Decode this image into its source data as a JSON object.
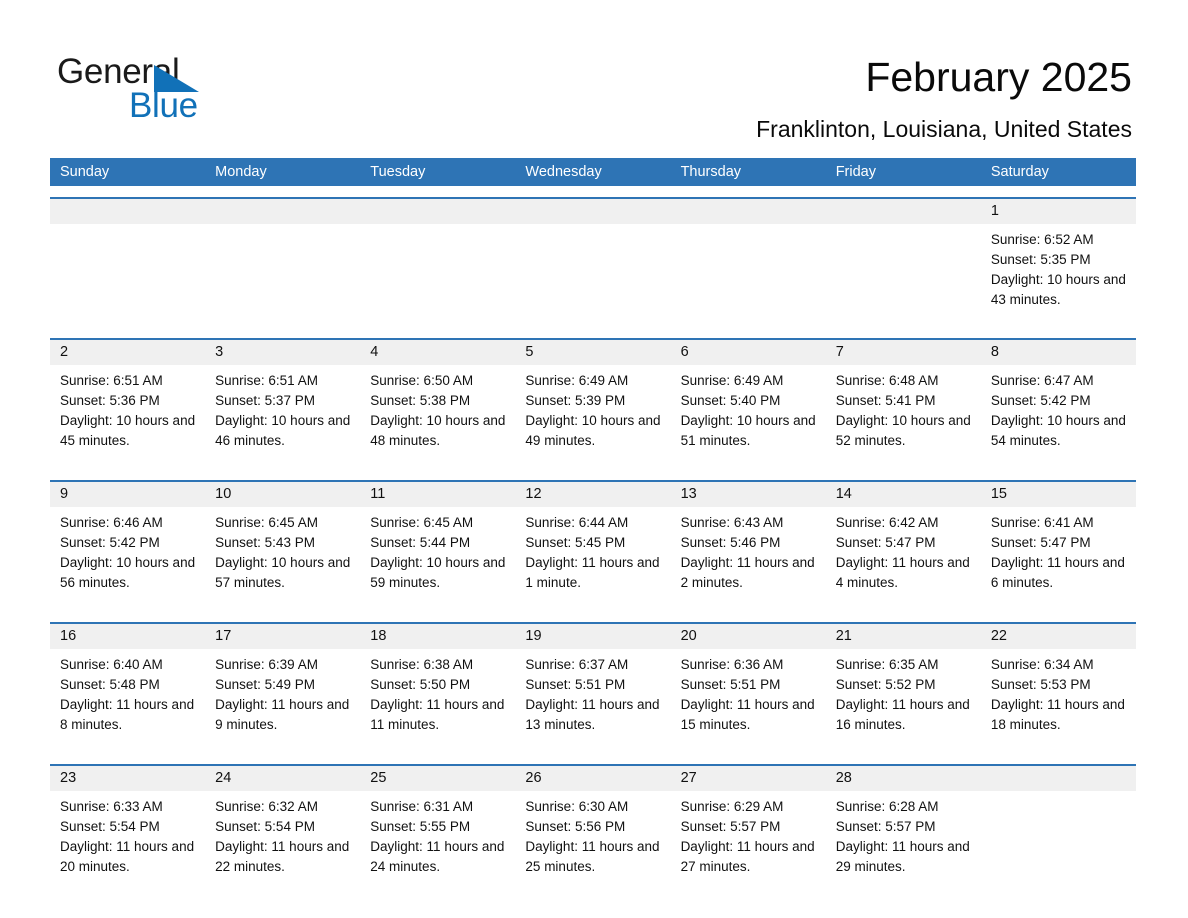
{
  "brand": {
    "name_part1": "General",
    "name_part2": "Blue",
    "triangle_color": "#1171b8"
  },
  "header": {
    "title": "February 2025",
    "subtitle": "Franklinton, Louisiana, United States",
    "header_bg_color": "#2e74b5",
    "row_divider_color": "#2e74b5",
    "daynum_band_color": "#f0f0f0"
  },
  "weekdays": [
    "Sunday",
    "Monday",
    "Tuesday",
    "Wednesday",
    "Thursday",
    "Friday",
    "Saturday"
  ],
  "weeks": [
    {
      "days": [
        {
          "num": "",
          "sunrise": "",
          "sunset": "",
          "daylight": ""
        },
        {
          "num": "",
          "sunrise": "",
          "sunset": "",
          "daylight": ""
        },
        {
          "num": "",
          "sunrise": "",
          "sunset": "",
          "daylight": ""
        },
        {
          "num": "",
          "sunrise": "",
          "sunset": "",
          "daylight": ""
        },
        {
          "num": "",
          "sunrise": "",
          "sunset": "",
          "daylight": ""
        },
        {
          "num": "",
          "sunrise": "",
          "sunset": "",
          "daylight": ""
        },
        {
          "num": "1",
          "sunrise": "Sunrise: 6:52 AM",
          "sunset": "Sunset: 5:35 PM",
          "daylight": "Daylight: 10 hours and 43 minutes."
        }
      ]
    },
    {
      "days": [
        {
          "num": "2",
          "sunrise": "Sunrise: 6:51 AM",
          "sunset": "Sunset: 5:36 PM",
          "daylight": "Daylight: 10 hours and 45 minutes."
        },
        {
          "num": "3",
          "sunrise": "Sunrise: 6:51 AM",
          "sunset": "Sunset: 5:37 PM",
          "daylight": "Daylight: 10 hours and 46 minutes."
        },
        {
          "num": "4",
          "sunrise": "Sunrise: 6:50 AM",
          "sunset": "Sunset: 5:38 PM",
          "daylight": "Daylight: 10 hours and 48 minutes."
        },
        {
          "num": "5",
          "sunrise": "Sunrise: 6:49 AM",
          "sunset": "Sunset: 5:39 PM",
          "daylight": "Daylight: 10 hours and 49 minutes."
        },
        {
          "num": "6",
          "sunrise": "Sunrise: 6:49 AM",
          "sunset": "Sunset: 5:40 PM",
          "daylight": "Daylight: 10 hours and 51 minutes."
        },
        {
          "num": "7",
          "sunrise": "Sunrise: 6:48 AM",
          "sunset": "Sunset: 5:41 PM",
          "daylight": "Daylight: 10 hours and 52 minutes."
        },
        {
          "num": "8",
          "sunrise": "Sunrise: 6:47 AM",
          "sunset": "Sunset: 5:42 PM",
          "daylight": "Daylight: 10 hours and 54 minutes."
        }
      ]
    },
    {
      "days": [
        {
          "num": "9",
          "sunrise": "Sunrise: 6:46 AM",
          "sunset": "Sunset: 5:42 PM",
          "daylight": "Daylight: 10 hours and 56 minutes."
        },
        {
          "num": "10",
          "sunrise": "Sunrise: 6:45 AM",
          "sunset": "Sunset: 5:43 PM",
          "daylight": "Daylight: 10 hours and 57 minutes."
        },
        {
          "num": "11",
          "sunrise": "Sunrise: 6:45 AM",
          "sunset": "Sunset: 5:44 PM",
          "daylight": "Daylight: 10 hours and 59 minutes."
        },
        {
          "num": "12",
          "sunrise": "Sunrise: 6:44 AM",
          "sunset": "Sunset: 5:45 PM",
          "daylight": "Daylight: 11 hours and 1 minute."
        },
        {
          "num": "13",
          "sunrise": "Sunrise: 6:43 AM",
          "sunset": "Sunset: 5:46 PM",
          "daylight": "Daylight: 11 hours and 2 minutes."
        },
        {
          "num": "14",
          "sunrise": "Sunrise: 6:42 AM",
          "sunset": "Sunset: 5:47 PM",
          "daylight": "Daylight: 11 hours and 4 minutes."
        },
        {
          "num": "15",
          "sunrise": "Sunrise: 6:41 AM",
          "sunset": "Sunset: 5:47 PM",
          "daylight": "Daylight: 11 hours and 6 minutes."
        }
      ]
    },
    {
      "days": [
        {
          "num": "16",
          "sunrise": "Sunrise: 6:40 AM",
          "sunset": "Sunset: 5:48 PM",
          "daylight": "Daylight: 11 hours and 8 minutes."
        },
        {
          "num": "17",
          "sunrise": "Sunrise: 6:39 AM",
          "sunset": "Sunset: 5:49 PM",
          "daylight": "Daylight: 11 hours and 9 minutes."
        },
        {
          "num": "18",
          "sunrise": "Sunrise: 6:38 AM",
          "sunset": "Sunset: 5:50 PM",
          "daylight": "Daylight: 11 hours and 11 minutes."
        },
        {
          "num": "19",
          "sunrise": "Sunrise: 6:37 AM",
          "sunset": "Sunset: 5:51 PM",
          "daylight": "Daylight: 11 hours and 13 minutes."
        },
        {
          "num": "20",
          "sunrise": "Sunrise: 6:36 AM",
          "sunset": "Sunset: 5:51 PM",
          "daylight": "Daylight: 11 hours and 15 minutes."
        },
        {
          "num": "21",
          "sunrise": "Sunrise: 6:35 AM",
          "sunset": "Sunset: 5:52 PM",
          "daylight": "Daylight: 11 hours and 16 minutes."
        },
        {
          "num": "22",
          "sunrise": "Sunrise: 6:34 AM",
          "sunset": "Sunset: 5:53 PM",
          "daylight": "Daylight: 11 hours and 18 minutes."
        }
      ]
    },
    {
      "days": [
        {
          "num": "23",
          "sunrise": "Sunrise: 6:33 AM",
          "sunset": "Sunset: 5:54 PM",
          "daylight": "Daylight: 11 hours and 20 minutes."
        },
        {
          "num": "24",
          "sunrise": "Sunrise: 6:32 AM",
          "sunset": "Sunset: 5:54 PM",
          "daylight": "Daylight: 11 hours and 22 minutes."
        },
        {
          "num": "25",
          "sunrise": "Sunrise: 6:31 AM",
          "sunset": "Sunset: 5:55 PM",
          "daylight": "Daylight: 11 hours and 24 minutes."
        },
        {
          "num": "26",
          "sunrise": "Sunrise: 6:30 AM",
          "sunset": "Sunset: 5:56 PM",
          "daylight": "Daylight: 11 hours and 25 minutes."
        },
        {
          "num": "27",
          "sunrise": "Sunrise: 6:29 AM",
          "sunset": "Sunset: 5:57 PM",
          "daylight": "Daylight: 11 hours and 27 minutes."
        },
        {
          "num": "28",
          "sunrise": "Sunrise: 6:28 AM",
          "sunset": "Sunset: 5:57 PM",
          "daylight": "Daylight: 11 hours and 29 minutes."
        },
        {
          "num": "",
          "sunrise": "",
          "sunset": "",
          "daylight": ""
        }
      ]
    }
  ]
}
